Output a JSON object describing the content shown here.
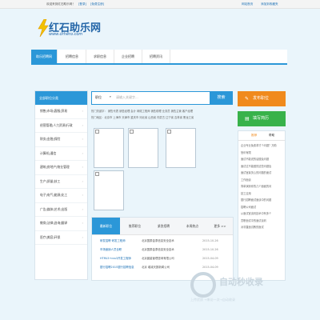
{
  "topbar": {
    "welcome": "欢迎来到红石助乐网！",
    "login": "[登录]",
    "register": "[免费注册]",
    "link1": "网站首页",
    "link2": "添加到收藏夹"
  },
  "logo": {
    "zh": "红石助乐网",
    "en": "www.orhero.com"
  },
  "nav": [
    "助乐招聘网",
    "招聘信息",
    "求职信息",
    "企业招聘",
    "招聘资讯"
  ],
  "sidebar": {
    "title": "全部职位分类",
    "items": [
      "销售|市场|客服|贸易",
      "经营管理|人力资源|行政",
      "财务|金融|保险",
      "计算机|通信",
      "建筑|房地产|物业管理",
      "生产|质量|技工",
      "电子|电气|能源|化工",
      "广告|媒体|艺术|出版",
      "教育|法律|咨询|翻译",
      "医疗|美容|环保"
    ]
  },
  "search": {
    "category": "职位",
    "placeholder": "请输入关键字...",
    "button": "搜索"
  },
  "hot": {
    "line1": "热门关键字：  销售代表   销售经理   会计   网络工程师   销售助理   业务员   销售主管   客户经理",
    "line2": "热门地区：北京市   上海市   天津市   重庆市   河北省   山西省   内蒙古   辽宁省   吉林省   黑龙江省"
  },
  "buttons": {
    "post_job": "发布职位",
    "fill_resume": "填写简历"
  },
  "rpanel": {
    "tabs": [
      "推荐",
      "帮助"
    ],
    "lines": [
      "企业专业免费求才个问题？万助",
      "慧讯有限",
      "面试不能说的话题及问题",
      "面试过不能做的这些问题及",
      "面试官最关心的问题的面试",
      "工作面谈",
      "简单演到你的几个面面的问",
      "技工应用",
      "银行招聘面试面谈中的问题",
      "招聘公司面试",
      "从面试官谈判技术中有多个",
      "员职面试中的面试谈判",
      "对非直面试教的面试"
    ]
  },
  "jobs": {
    "tabs": [
      "最新职位",
      "推荐职位",
      "紧急招聘",
      "本周热点",
      "更多 >>"
    ],
    "rows": [
      {
        "title": "研发招聘 研发工程师",
        "company": "北京国泰金泰信息安全技术",
        "date": "2015-10-26"
      },
      {
        "title": "市场营销人员全职",
        "company": "北京国泰金泰信息安全技术",
        "date": "2015-10-26"
      },
      {
        "title": "HTML5+css3开发工程师",
        "company": "北京晨星管理咨询有限公司",
        "date": "2015-04-09"
      },
      {
        "title": "银行招聘2015银行招聘信息",
        "company": "北京 增减天数新闻公司",
        "date": "2015-04-09"
      }
    ]
  },
  "watermark": {
    "text": "自动秒收录",
    "sub": "上传优质 →来访一次→自动收录"
  },
  "colors": {
    "accent": "#2b97d8",
    "orange": "#f08a1c",
    "green": "#38b24a",
    "bg": "#eaf5fb"
  }
}
